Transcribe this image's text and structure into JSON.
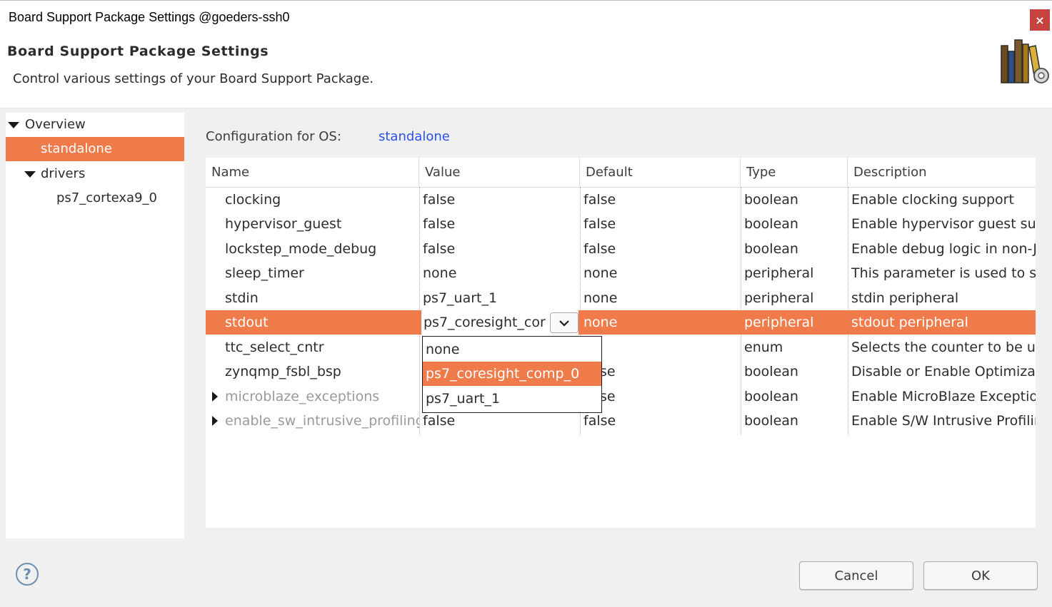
{
  "window": {
    "title": "Board Support Package Settings @goeders-ssh0",
    "close_label": "×"
  },
  "header": {
    "title": "Board Support Package Settings",
    "subtitle": "Control various settings of your Board Support Package."
  },
  "tree": {
    "items": [
      {
        "label": "Overview",
        "expanded": true
      },
      {
        "label": "standalone",
        "selected": true
      },
      {
        "label": "drivers",
        "expanded": true
      },
      {
        "label": "ps7_cortexa9_0"
      }
    ]
  },
  "config": {
    "label": "Configuration for OS:",
    "os": "standalone"
  },
  "table": {
    "columns": [
      "Name",
      "Value",
      "Default",
      "Type",
      "Description"
    ],
    "rows": [
      {
        "name": "clocking",
        "value": "false",
        "default": "false",
        "type": "boolean",
        "description": "Enable clocking support"
      },
      {
        "name": "hypervisor_guest",
        "value": "false",
        "default": "false",
        "type": "boolean",
        "description": "Enable hypervisor guest su"
      },
      {
        "name": "lockstep_mode_debug",
        "value": "false",
        "default": "false",
        "type": "boolean",
        "description": "Enable debug logic in non-J"
      },
      {
        "name": "sleep_timer",
        "value": "none",
        "default": "none",
        "type": "peripheral",
        "description": "This parameter is used to s"
      },
      {
        "name": "stdin",
        "value": "ps7_uart_1",
        "default": "none",
        "type": "peripheral",
        "description": "stdin peripheral"
      },
      {
        "name": "stdout",
        "value": "ps7_coresight_cor",
        "default": "none",
        "type": "peripheral",
        "description": "stdout peripheral",
        "selected": true
      },
      {
        "name": "ttc_select_cntr",
        "value": "",
        "default": "",
        "type": "enum",
        "description": "Selects the counter to be u"
      },
      {
        "name": "zynqmp_fsbl_bsp",
        "value": "",
        "default": "se",
        "type": "boolean",
        "description": "Disable or Enable Optimiza"
      },
      {
        "name": "microblaze_exceptions",
        "value": "",
        "default": "se",
        "type": "boolean",
        "description": "Enable MicroBlaze Exceptio",
        "collapsed": true,
        "disabled": true
      },
      {
        "name": "enable_sw_intrusive_profiling",
        "value": "false",
        "default": "false",
        "type": "boolean",
        "description": "Enable S/W Intrusive Profilir",
        "collapsed": true,
        "disabled": true
      }
    ]
  },
  "dropdown": {
    "current": "ps7_coresight_cor",
    "options": [
      "none",
      "ps7_coresight_comp_0",
      "ps7_uart_1"
    ],
    "highlighted": "ps7_coresight_comp_0"
  },
  "footer": {
    "help": "?",
    "cancel_label": "Cancel",
    "ok_label": "OK"
  },
  "colors": {
    "selection": "#f07b4a",
    "link": "#2a4ff0",
    "close": "#c7433d"
  }
}
